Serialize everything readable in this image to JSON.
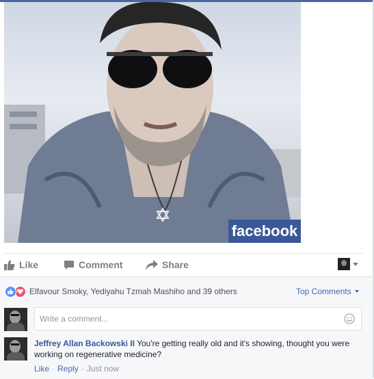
{
  "photo": {
    "watermark": "facebook",
    "colors": {
      "badge_bg": "#3b5998"
    }
  },
  "actions": {
    "like": "Like",
    "comment": "Comment",
    "share": "Share",
    "icons": [
      "thumbs-up-icon",
      "comment-bubble-icon",
      "share-arrow-icon"
    ]
  },
  "reactions": {
    "types": [
      "like",
      "love"
    ],
    "summary": "Elfavour Smoky, Yediyahu Tzmah Mashiho and 39 others",
    "sort_label": "Top Comments"
  },
  "composer": {
    "placeholder": "Write a comment..."
  },
  "comments": [
    {
      "author": "Jeffrey Allan Backowski II",
      "text": "You're getting really old and it's showing, thought you were working on regenerative medicine?",
      "like_label": "Like",
      "reply_label": "Reply",
      "timestamp": "Just now"
    }
  ],
  "colors": {
    "link": "#4267b2",
    "author": "#365899",
    "muted": "#90949c",
    "like_reaction": "#5890ff",
    "love_reaction": "#f25268"
  }
}
